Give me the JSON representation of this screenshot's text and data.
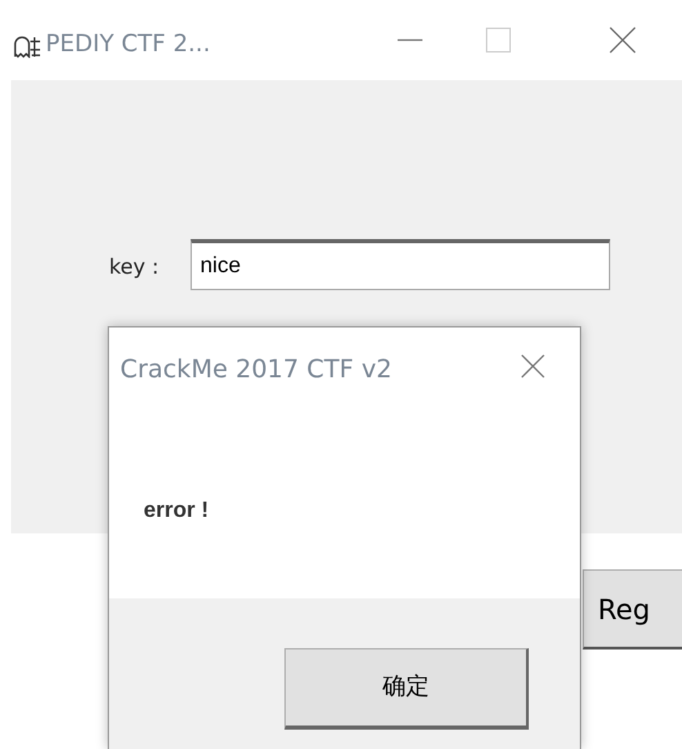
{
  "main_window": {
    "title": "PEDIY CTF 2...",
    "key_label": "key :",
    "key_value": "nice",
    "button": "Reg"
  },
  "dialog": {
    "title": "CrackMe 2017 CTF v2",
    "message": "error !",
    "button": "确定"
  }
}
